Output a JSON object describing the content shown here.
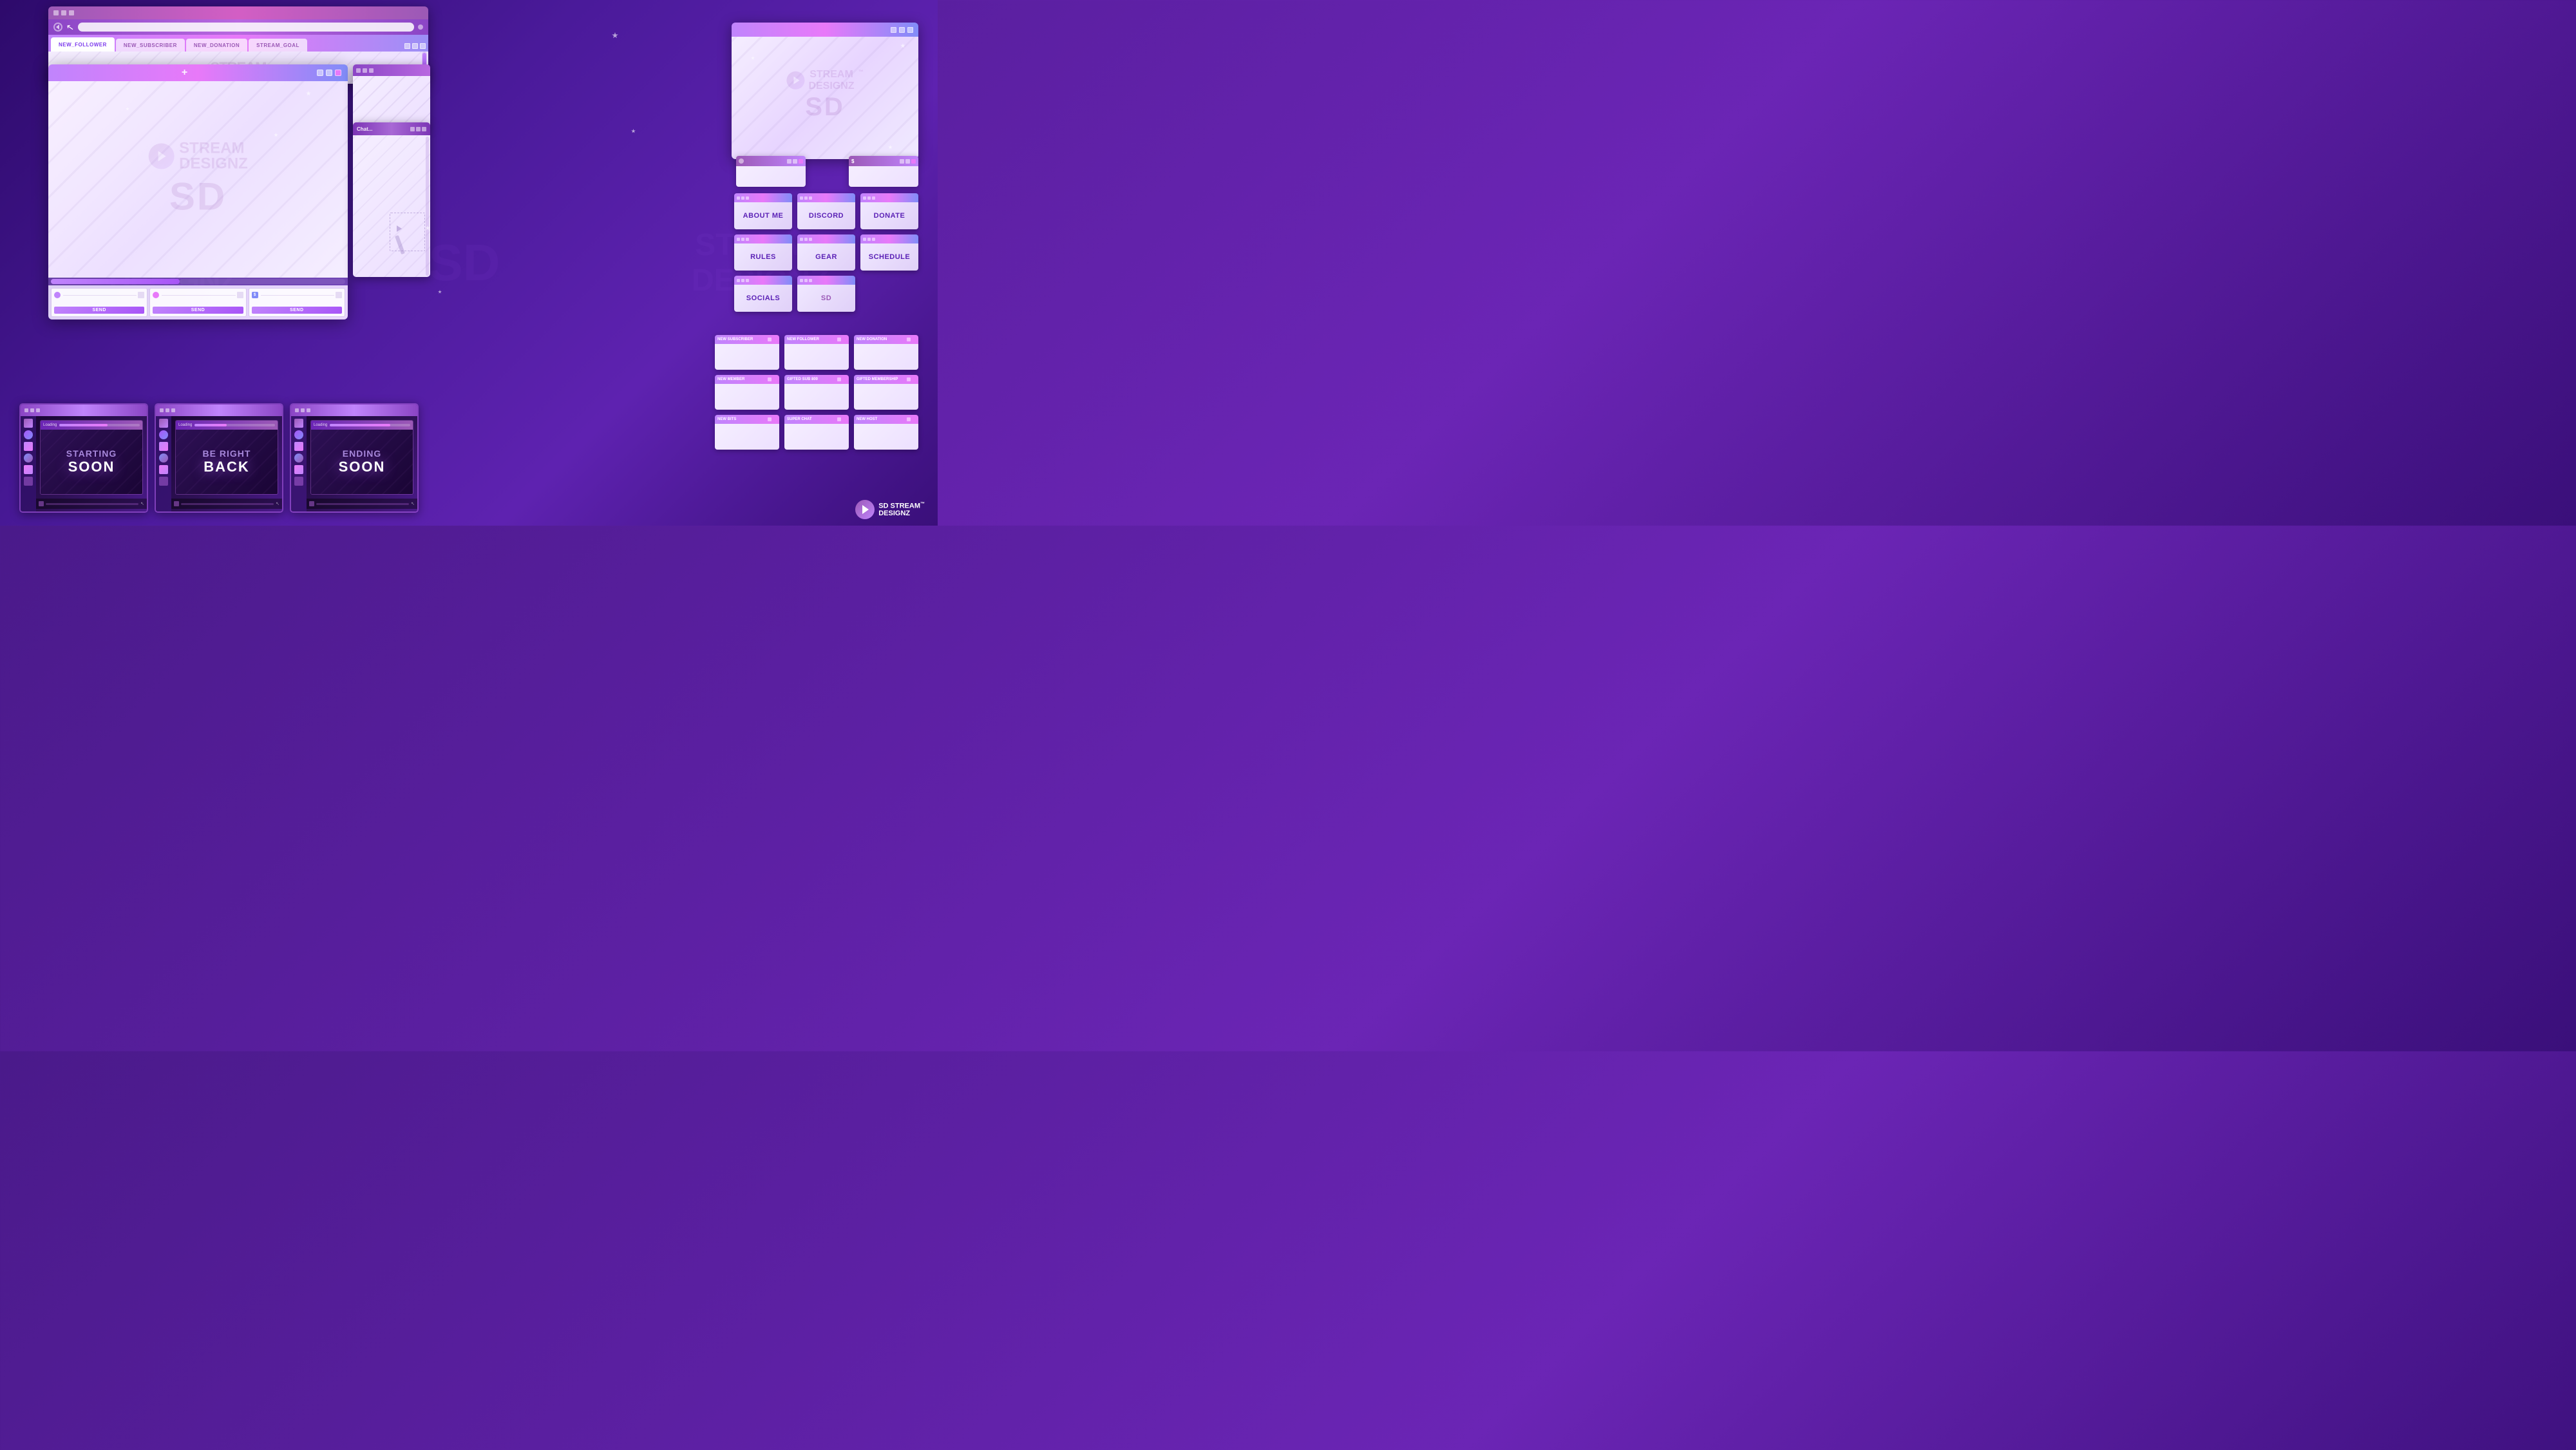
{
  "brand": {
    "name": "Stream Designz",
    "tm": "™",
    "logo_text": "SD"
  },
  "browser_window": {
    "title": "",
    "tabs": [
      {
        "label": "NEW_FOLLOWER",
        "active": true
      },
      {
        "label": "NEW_SUBSCRIBER",
        "active": false
      },
      {
        "label": "NEW_DONATION",
        "active": false
      },
      {
        "label": "STREAM_GOAL",
        "active": false
      }
    ],
    "window_controls": [
      "min",
      "max",
      "close"
    ]
  },
  "main_window": {
    "title": "+",
    "scrollbar_label": ""
  },
  "chat_window": {
    "title": "Chat..."
  },
  "input_panels": [
    {
      "icon": "heart",
      "send_label": "SEND"
    },
    {
      "icon": "heart",
      "send_label": "SEND"
    },
    {
      "icon": "dollar",
      "send_label": "SEND"
    }
  ],
  "panel_buttons": [
    {
      "label": "ABOUT ME",
      "row": 1,
      "col": 1
    },
    {
      "label": "DISCORD",
      "row": 1,
      "col": 2
    },
    {
      "label": "DONATE",
      "row": 1,
      "col": 3
    },
    {
      "label": "RULES",
      "row": 2,
      "col": 1
    },
    {
      "label": "GEAR",
      "row": 2,
      "col": 2
    },
    {
      "label": "SCHEDULE",
      "row": 2,
      "col": 3
    },
    {
      "label": "SOCIALS",
      "row": 3,
      "col": 1
    },
    {
      "label": "...",
      "row": 3,
      "col": 2
    }
  ],
  "alert_windows": [
    {
      "label": "NEW SUBSCRIBER"
    },
    {
      "label": "NEW FOLLOWER"
    },
    {
      "label": "NEW DONATION"
    },
    {
      "label": "NEW MEMBER"
    },
    {
      "label": "GIFTED SUB 800"
    },
    {
      "label": "GIFTED MEMBERSHIP"
    },
    {
      "label": "NEW BITS"
    },
    {
      "label": "SUPER CHAT"
    },
    {
      "label": "NEW HOST"
    }
  ],
  "overlay_screens": [
    {
      "title": "STARTING SOON",
      "line1": "STARTING",
      "line2": "SOON"
    },
    {
      "title": "BE RIGHT BACK",
      "line1": "BE RIGHT",
      "line2": "BACK"
    },
    {
      "title": "ENDING SOON",
      "line1": "ENDING",
      "line2": "SOON"
    }
  ],
  "colors": {
    "bg_dark": "#3a0f7a",
    "bg_mid": "#5a1fa0",
    "accent_pink": "#e879f9",
    "accent_purple": "#c084fc",
    "accent_blue": "#818cf8",
    "window_light": "#f5eeff",
    "panel_text": "#5b21b6"
  }
}
